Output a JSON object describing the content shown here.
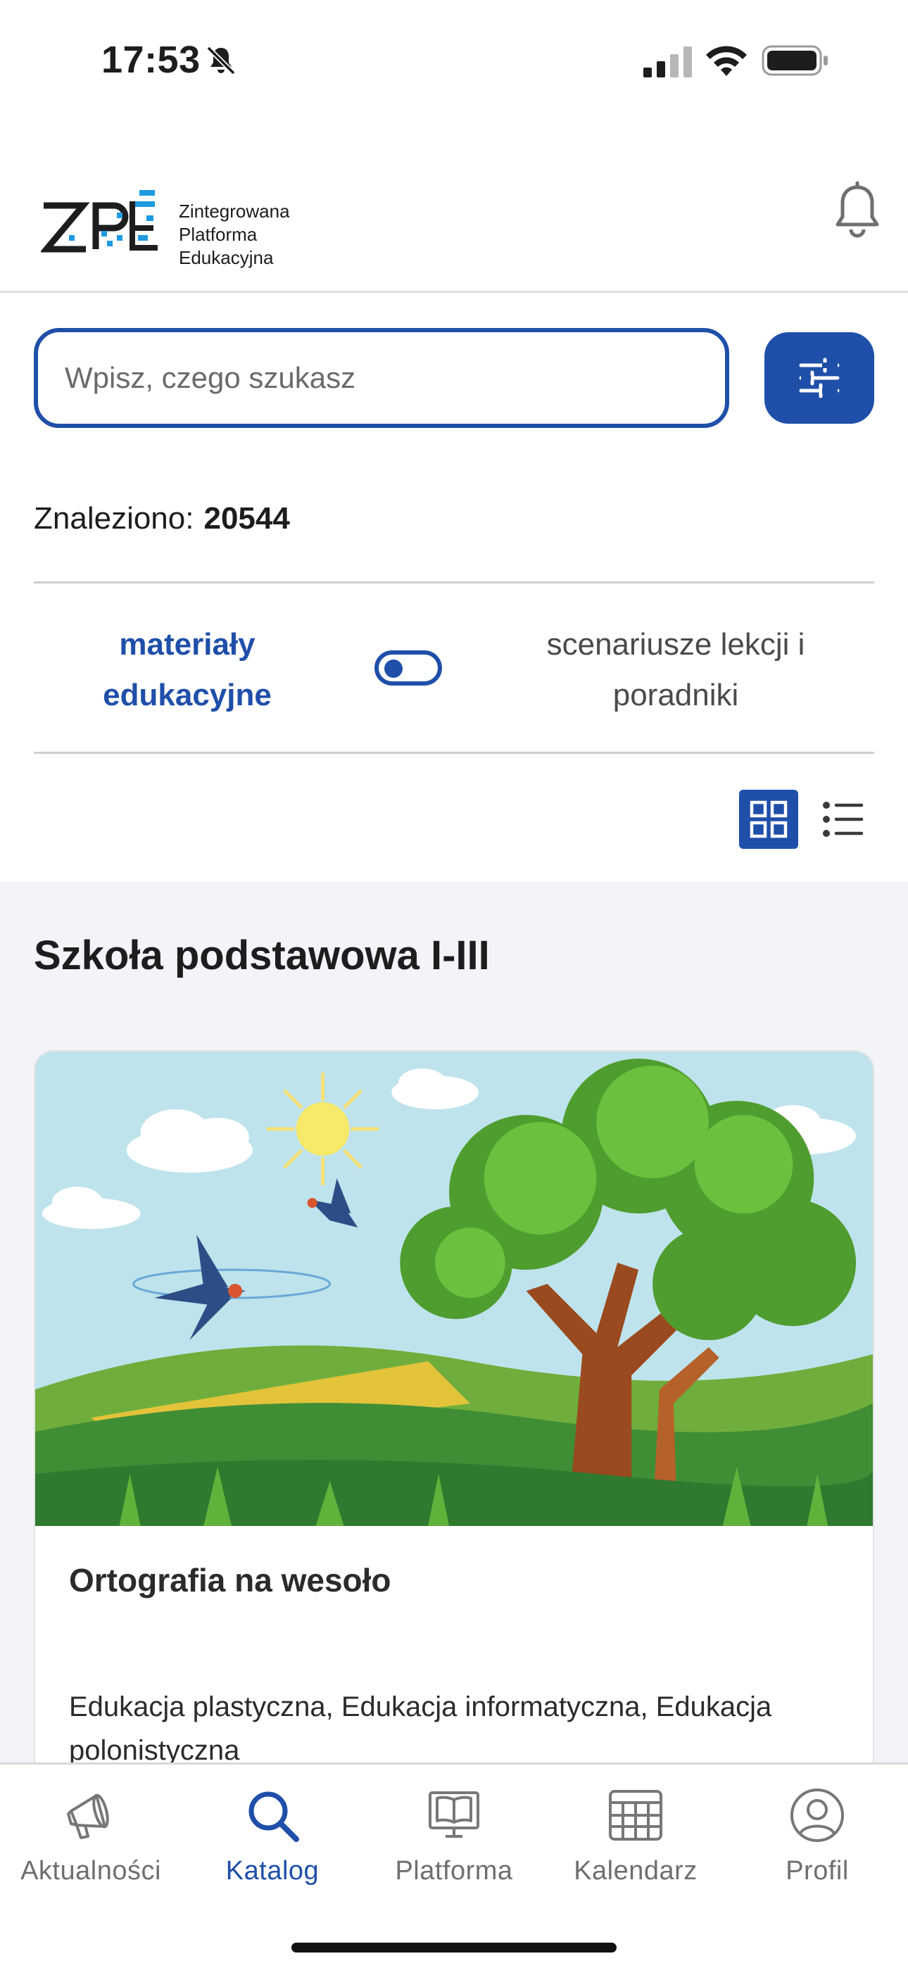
{
  "status_bar": {
    "time": "17:53"
  },
  "header": {
    "logo_letters": "ZPE",
    "logo_line1": "Zintegrowana",
    "logo_line2": "Platforma",
    "logo_line3": "Edukacyjna"
  },
  "search": {
    "placeholder": "Wpisz, czego szukasz",
    "value": ""
  },
  "results": {
    "label": "Znaleziono:",
    "count": "20544"
  },
  "mode_toggle": {
    "left_line1": "materiały",
    "left_line2": "edukacyjne",
    "right_line1": "scenariusze lekcji i",
    "right_line2": "poradniki",
    "selected": "left"
  },
  "view": {
    "selected": "grid"
  },
  "section": {
    "title": "Szkoła podstawowa I-III"
  },
  "card": {
    "title": "Ortografia na wesoło",
    "subjects_line1": "Edukacja plastyczna, Edukacja informatyczna, Edukacja",
    "subjects_line2": "polonistyczna"
  },
  "tabs": [
    {
      "label": "Aktualności",
      "icon": "megaphone-icon"
    },
    {
      "label": "Katalog",
      "icon": "search-icon",
      "active": true
    },
    {
      "label": "Platforma",
      "icon": "book-screen-icon"
    },
    {
      "label": "Kalendarz",
      "icon": "calendar-icon"
    },
    {
      "label": "Profil",
      "icon": "user-icon"
    }
  ],
  "colors": {
    "accent": "#1f4fa9",
    "logo_blue": "#1e9be0",
    "background_section": "#f3f4f8"
  }
}
